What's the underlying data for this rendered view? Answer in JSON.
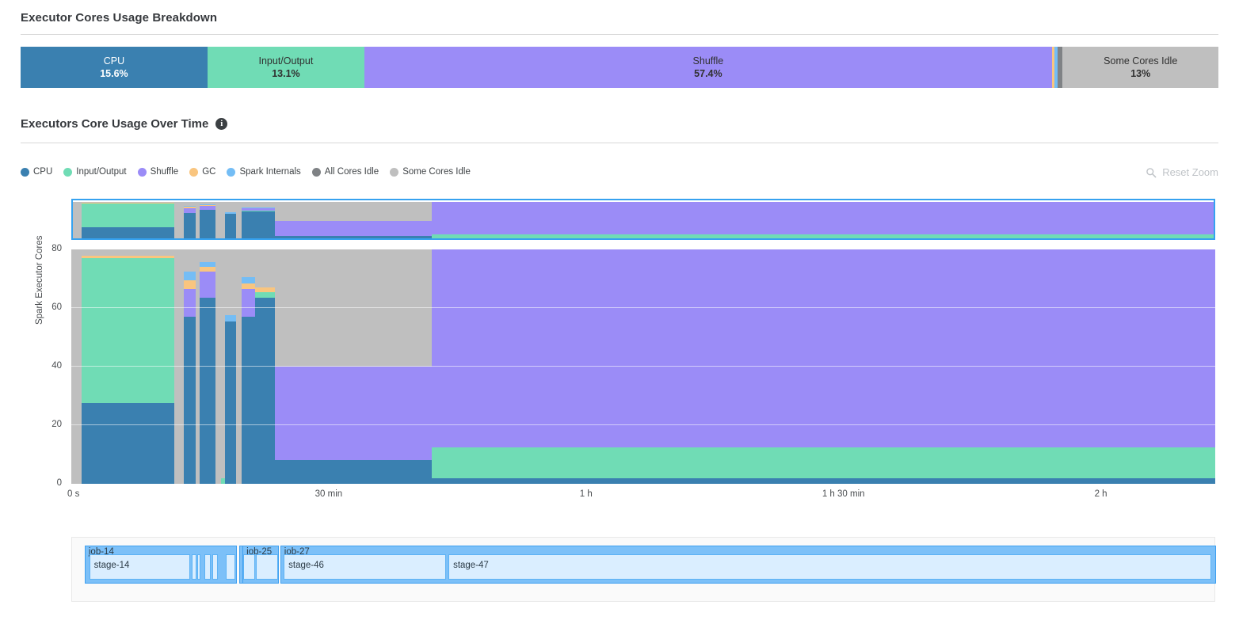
{
  "colors": {
    "cpu": "#3a80b0",
    "io": "#70dcb5",
    "shuffle": "#9b8cf7",
    "gc": "#f9c57f",
    "spark_internals": "#74bdf5",
    "all_cores_idle": "#7f8285",
    "some_cores_idle": "#bfbfbf",
    "accent_blue": "#36a2f0",
    "job_fill": "#7cc0f8",
    "stage_fill": "#daeeff",
    "rule": "#d8d8d8",
    "text": "#36393d",
    "muted": "#bfc3c7"
  },
  "breakdown": {
    "title": "Executor Cores Usage Breakdown",
    "segments": [
      {
        "label": "CPU",
        "value": "15.6%",
        "pct": 15.6,
        "color": "#3a80b0",
        "text": "light",
        "show_text": true
      },
      {
        "label": "Input/Output",
        "value": "13.1%",
        "pct": 13.1,
        "color": "#70dcb5",
        "text": "dark",
        "show_text": true
      },
      {
        "label": "Shuffle",
        "value": "57.4%",
        "pct": 57.4,
        "color": "#9b8cf7",
        "text": "dark",
        "show_text": true
      },
      {
        "label": "GC",
        "value": "0.2%",
        "pct": 0.22,
        "color": "#f9c57f",
        "text": "dark",
        "show_text": false
      },
      {
        "label": "Spark Internals",
        "value": "0.3%",
        "pct": 0.28,
        "color": "#74bdf5",
        "text": "dark",
        "show_text": false
      },
      {
        "label": "All Cores Idle",
        "value": "0.4%",
        "pct": 0.4,
        "color": "#7f8285",
        "text": "light",
        "show_text": false
      },
      {
        "label": "Some Cores Idle",
        "value": "13%",
        "pct": 13.0,
        "color": "#bfbfbf",
        "text": "dark",
        "show_text": true
      }
    ]
  },
  "usage_over_time": {
    "title": "Executors Core Usage Over Time",
    "info_glyph": "i",
    "reset_zoom_label": "Reset Zoom",
    "reset_zoom_icon": "search-icon",
    "legend": [
      {
        "label": "CPU",
        "color": "#3a80b0"
      },
      {
        "label": "Input/Output",
        "color": "#70dcb5"
      },
      {
        "label": "Shuffle",
        "color": "#9b8cf7"
      },
      {
        "label": "GC",
        "color": "#f9c57f"
      },
      {
        "label": "Spark Internals",
        "color": "#74bdf5"
      },
      {
        "label": "All Cores Idle",
        "color": "#7f8285"
      },
      {
        "label": "Some Cores Idle",
        "color": "#bfbfbf"
      }
    ]
  },
  "chart_data": {
    "type": "area",
    "title": "Executors Core Usage Over Time",
    "xlabel": "",
    "ylabel": "Spark Executor Cores",
    "ylim": [
      0,
      80
    ],
    "yticks": [
      0,
      20,
      40,
      60,
      80
    ],
    "xlim_seconds": [
      0,
      8000
    ],
    "xticks": [
      {
        "label": "0 s",
        "seconds": 0
      },
      {
        "label": "30 min",
        "seconds": 1800
      },
      {
        "label": "1 h",
        "seconds": 3600
      },
      {
        "label": "1 h 30 min",
        "seconds": 5400
      },
      {
        "label": "2 h",
        "seconds": 7200
      }
    ],
    "grid": true,
    "legend_position": "top-left",
    "stack_order": [
      "cpu",
      "io",
      "shuffle",
      "gc",
      "spark_internals",
      "all_cores_idle",
      "some_cores_idle"
    ],
    "series": [
      {
        "name": "CPU",
        "key": "cpu",
        "color": "#3a80b0"
      },
      {
        "name": "Input/Output",
        "key": "io",
        "color": "#70dcb5"
      },
      {
        "name": "Shuffle",
        "key": "shuffle",
        "color": "#9b8cf7"
      },
      {
        "name": "GC",
        "key": "gc",
        "color": "#f9c57f"
      },
      {
        "name": "Spark Internals",
        "key": "spark_internals",
        "color": "#74bdf5"
      },
      {
        "name": "All Cores Idle",
        "key": "all_cores_idle",
        "color": "#7f8285"
      },
      {
        "name": "Some Cores Idle",
        "key": "some_cores_idle",
        "color": "#bfbfbf"
      }
    ],
    "intervals": [
      {
        "x0": 0.0,
        "x1": 0.28,
        "cpu": 0,
        "io": 0,
        "shuffle": 0,
        "gc": 0,
        "spark_internals": 0,
        "all_cores_idle": 0,
        "some_cores_idle": 80
      },
      {
        "x0": 0.28,
        "x1": 0.55,
        "cpu": 0,
        "io": 0,
        "shuffle": 0,
        "gc": 0,
        "spark_internals": 0,
        "all_cores_idle": 0,
        "some_cores_idle": 80
      },
      {
        "x0": 0.55,
        "x1": 0.9,
        "cpu": 0,
        "io": 0,
        "shuffle": 0,
        "gc": 0,
        "spark_internals": 0,
        "all_cores_idle": 0,
        "some_cores_idle": 80
      },
      {
        "x0": 0.9,
        "x1": 9.0,
        "cpu": 27.5,
        "io": 49.5,
        "shuffle": 0,
        "gc": 0.8,
        "spark_internals": 0,
        "all_cores_idle": 0,
        "some_cores_idle": 2.2
      },
      {
        "x0": 9.0,
        "x1": 9.8,
        "cpu": 0,
        "io": 0,
        "shuffle": 0,
        "gc": 0,
        "spark_internals": 0,
        "all_cores_idle": 0,
        "some_cores_idle": 80
      },
      {
        "x0": 9.8,
        "x1": 10.9,
        "cpu": 57.0,
        "io": 0,
        "shuffle": 9.5,
        "gc": 3.0,
        "spark_internals": 3.0,
        "all_cores_idle": 0,
        "some_cores_idle": 7.5
      },
      {
        "x0": 10.9,
        "x1": 11.25,
        "cpu": 0,
        "io": 0,
        "shuffle": 0,
        "gc": 0,
        "spark_internals": 0,
        "all_cores_idle": 0,
        "some_cores_idle": 80
      },
      {
        "x0": 11.25,
        "x1": 12.6,
        "cpu": 63.5,
        "io": 0,
        "shuffle": 9.0,
        "gc": 1.6,
        "spark_internals": 1.6,
        "all_cores_idle": 0,
        "some_cores_idle": 4.3
      },
      {
        "x0": 12.6,
        "x1": 13.1,
        "cpu": 0,
        "io": 0,
        "shuffle": 0,
        "gc": 0,
        "spark_internals": 0,
        "all_cores_idle": 0,
        "some_cores_idle": 80
      },
      {
        "x0": 13.1,
        "x1": 13.45,
        "cpu": 0,
        "io": 2.0,
        "shuffle": 0,
        "gc": 0,
        "spark_internals": 0,
        "all_cores_idle": 0,
        "some_cores_idle": 78
      },
      {
        "x0": 13.45,
        "x1": 14.4,
        "cpu": 55.5,
        "io": 0,
        "shuffle": 0,
        "gc": 0,
        "spark_internals": 2.2,
        "all_cores_idle": 0,
        "some_cores_idle": 22.3
      },
      {
        "x0": 14.4,
        "x1": 14.9,
        "cpu": 0,
        "io": 0,
        "shuffle": 0,
        "gc": 0,
        "spark_internals": 0,
        "all_cores_idle": 0,
        "some_cores_idle": 80
      },
      {
        "x0": 14.9,
        "x1": 16.1,
        "cpu": 57.0,
        "io": 0,
        "shuffle": 9.5,
        "gc": 2.0,
        "spark_internals": 2.0,
        "all_cores_idle": 0,
        "some_cores_idle": 9.5
      },
      {
        "x0": 16.1,
        "x1": 17.8,
        "cpu": 63.5,
        "io": 1.8,
        "shuffle": 0,
        "gc": 1.6,
        "spark_internals": 0,
        "all_cores_idle": 0,
        "some_cores_idle": 13.1
      },
      {
        "x0": 17.8,
        "x1": 31.5,
        "cpu": 8.0,
        "io": 0,
        "shuffle": 32.0,
        "gc": 0,
        "spark_internals": 0,
        "all_cores_idle": 0,
        "some_cores_idle": 40.0
      },
      {
        "x0": 31.5,
        "x1": 100.0,
        "cpu": 2.0,
        "io": 10.5,
        "shuffle": 67.5,
        "gc": 0,
        "spark_internals": 0,
        "all_cores_idle": 0,
        "some_cores_idle": 0
      }
    ],
    "overview_intervals": [
      {
        "x0": 0.0,
        "x1": 0.9,
        "cpu": 0,
        "io": 0,
        "shuffle": 0,
        "gc": 0,
        "spark_internals": 0,
        "all_cores_idle": 0,
        "some_cores_idle": 80
      },
      {
        "x0": 0.9,
        "x1": 9.0,
        "cpu": 27.5,
        "io": 49.5,
        "shuffle": 0,
        "gc": 0.8,
        "spark_internals": 0,
        "all_cores_idle": 0,
        "some_cores_idle": 2.2
      },
      {
        "x0": 9.0,
        "x1": 9.8,
        "cpu": 0,
        "io": 0,
        "shuffle": 0,
        "gc": 0,
        "spark_internals": 0,
        "all_cores_idle": 0,
        "some_cores_idle": 80
      },
      {
        "x0": 9.8,
        "x1": 10.9,
        "cpu": 57.0,
        "io": 0,
        "shuffle": 9.5,
        "gc": 3.0,
        "spark_internals": 3.0,
        "all_cores_idle": 0,
        "some_cores_idle": 7.5
      },
      {
        "x0": 10.9,
        "x1": 11.25,
        "cpu": 0,
        "io": 0,
        "shuffle": 0,
        "gc": 0,
        "spark_internals": 0,
        "all_cores_idle": 0,
        "some_cores_idle": 80
      },
      {
        "x0": 11.25,
        "x1": 12.6,
        "cpu": 63.5,
        "io": 0,
        "shuffle": 9.0,
        "gc": 1.6,
        "spark_internals": 1.6,
        "all_cores_idle": 0,
        "some_cores_idle": 4.3
      },
      {
        "x0": 12.6,
        "x1": 13.45,
        "cpu": 0,
        "io": 2.0,
        "shuffle": 0,
        "gc": 0,
        "spark_internals": 0,
        "all_cores_idle": 0,
        "some_cores_idle": 78
      },
      {
        "x0": 13.45,
        "x1": 14.4,
        "cpu": 55.5,
        "io": 0,
        "shuffle": 0,
        "gc": 0,
        "spark_internals": 2.2,
        "all_cores_idle": 0,
        "some_cores_idle": 22.3
      },
      {
        "x0": 14.4,
        "x1": 14.9,
        "cpu": 0,
        "io": 0,
        "shuffle": 0,
        "gc": 0,
        "spark_internals": 0,
        "all_cores_idle": 0,
        "some_cores_idle": 80
      },
      {
        "x0": 14.9,
        "x1": 17.8,
        "cpu": 60.0,
        "io": 1.0,
        "shuffle": 5.0,
        "gc": 1.8,
        "spark_internals": 1.0,
        "all_cores_idle": 0,
        "some_cores_idle": 11.2
      },
      {
        "x0": 17.8,
        "x1": 31.5,
        "cpu": 8.0,
        "io": 0,
        "shuffle": 32.0,
        "gc": 0,
        "spark_internals": 0,
        "all_cores_idle": 0,
        "some_cores_idle": 40.0
      },
      {
        "x0": 31.5,
        "x1": 100.0,
        "cpu": 2.0,
        "io": 10.5,
        "shuffle": 67.5,
        "gc": 0,
        "spark_internals": 0,
        "all_cores_idle": 0,
        "some_cores_idle": 0
      }
    ]
  },
  "timeline": {
    "jobs": [
      {
        "label": "job-14",
        "x0": 1.1,
        "x1": 14.4,
        "show_label": true
      },
      {
        "label": "",
        "x0": 14.6,
        "x1": 15.25,
        "show_label": false
      },
      {
        "label": "job-25",
        "x0": 14.9,
        "x1": 18.1,
        "show_label": true
      },
      {
        "label": "job-27",
        "x0": 18.2,
        "x1": 100.0,
        "show_label": true
      }
    ],
    "stages": [
      {
        "label": "stage-14",
        "x0": 1.5,
        "x1": 10.3,
        "show_label": true
      },
      {
        "label": "",
        "x0": 10.45,
        "x1": 10.85,
        "show_label": false
      },
      {
        "label": "",
        "x0": 10.95,
        "x1": 11.2,
        "show_label": false
      },
      {
        "label": "",
        "x0": 11.55,
        "x1": 12.15,
        "show_label": false
      },
      {
        "label": "",
        "x0": 12.25,
        "x1": 12.75,
        "show_label": false
      },
      {
        "label": "",
        "x0": 13.45,
        "x1": 14.25,
        "show_label": false
      },
      {
        "label": "",
        "x0": 14.95,
        "x1": 16.0,
        "show_label": false
      },
      {
        "label": "",
        "x0": 16.1,
        "x1": 18.0,
        "show_label": false
      },
      {
        "label": "stage-46",
        "x0": 18.5,
        "x1": 32.7,
        "show_label": true
      },
      {
        "label": "stage-47",
        "x0": 32.9,
        "x1": 99.6,
        "show_label": true
      }
    ]
  }
}
